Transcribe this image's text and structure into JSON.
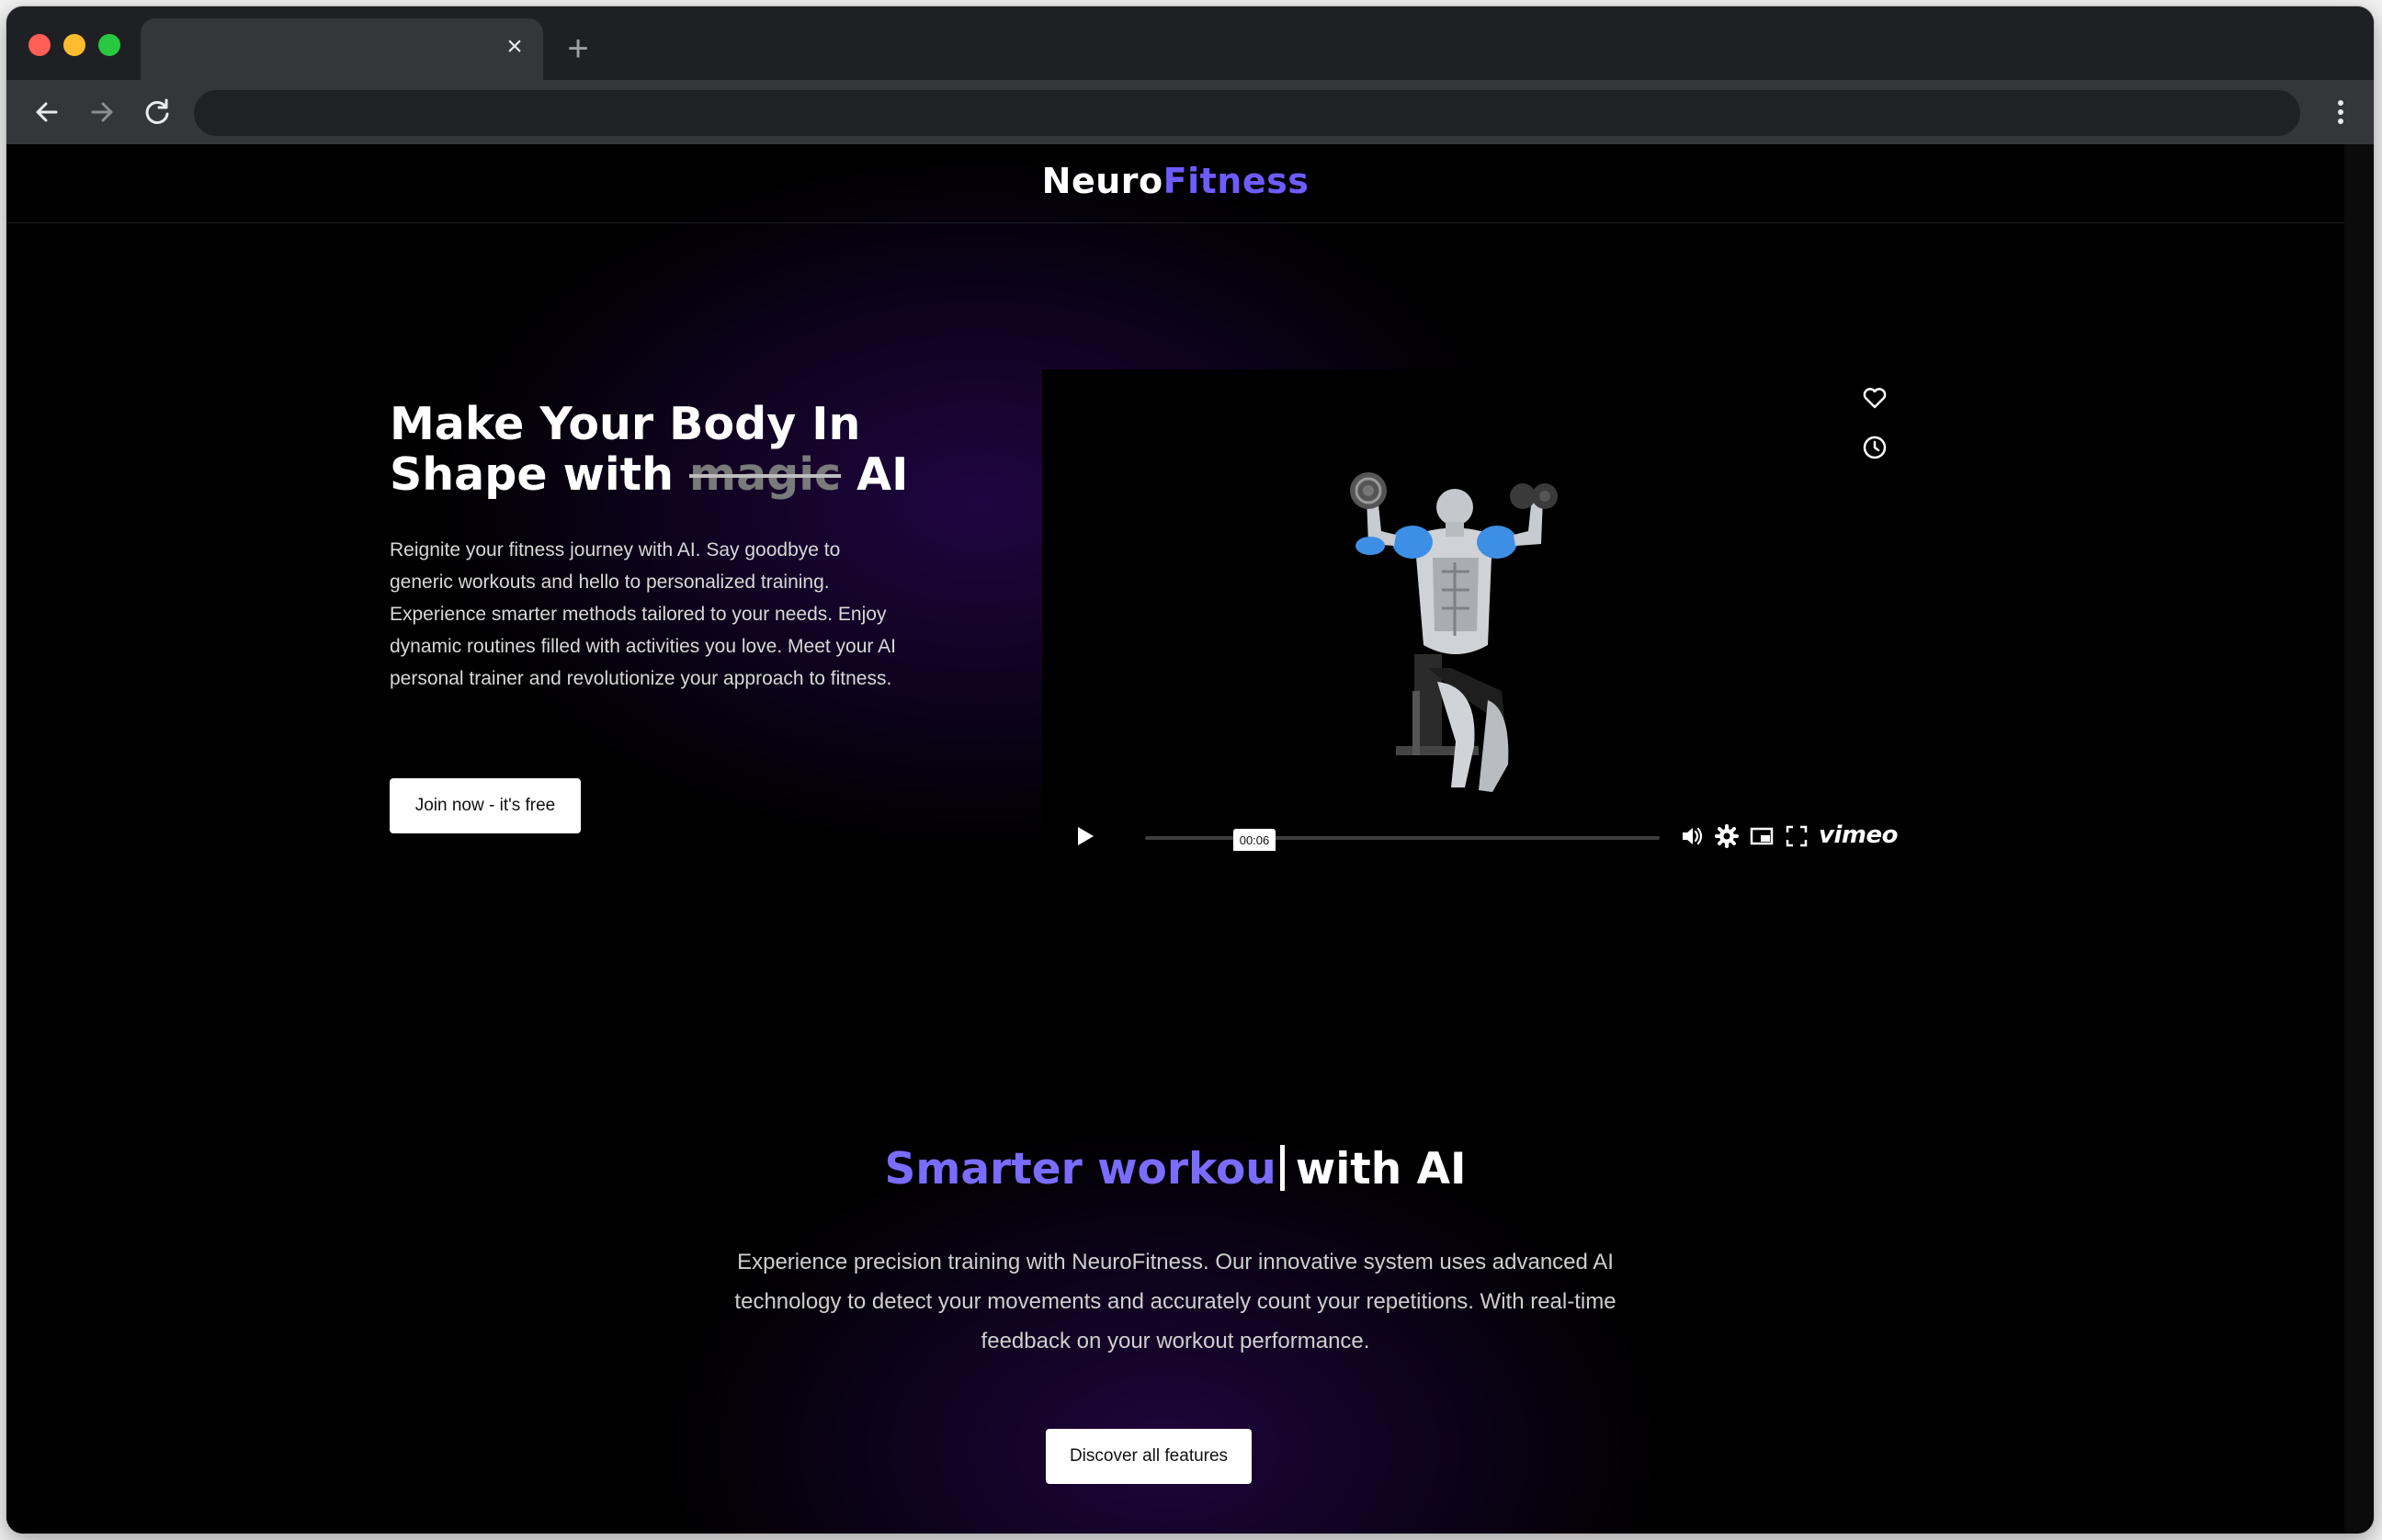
{
  "browser": {
    "tab_title": "",
    "tab_close_glyph": "×",
    "new_tab_glyph": "+",
    "address_value": ""
  },
  "site": {
    "logo_part1": "Neuro",
    "logo_part2": "Fitness",
    "brand_accent": "#6d5cff"
  },
  "hero": {
    "title_line1": "Make Your Body In",
    "title_line2_prefix": "Shape with ",
    "title_struck": "magic",
    "title_line2_suffix": " AI",
    "description": "Reignite your fitness journey with AI. Say goodbye to generic workouts and hello to personalized training. Experience smarter methods tailored to your needs. Enjoy dynamic routines filled with activities you love. Meet your AI personal trainer and revolutionize your approach to fitness.",
    "cta_label": "Join now - it's free"
  },
  "video": {
    "time_label": "00:06",
    "brand": "vimeo",
    "progress_fraction": 0.0,
    "icons": [
      "heart-icon",
      "clock-icon",
      "play-icon",
      "volume-icon",
      "settings-icon",
      "pip-icon",
      "fullscreen-icon"
    ]
  },
  "features": {
    "title_accent": "Smarter workou",
    "title_rest": "with AI",
    "description": "Experience precision training with NeuroFitness. Our innovative system uses advanced AI technology to detect your movements and accurately count your repetitions. With real-time feedback on your workout performance.",
    "cta_label": "Discover all features"
  }
}
